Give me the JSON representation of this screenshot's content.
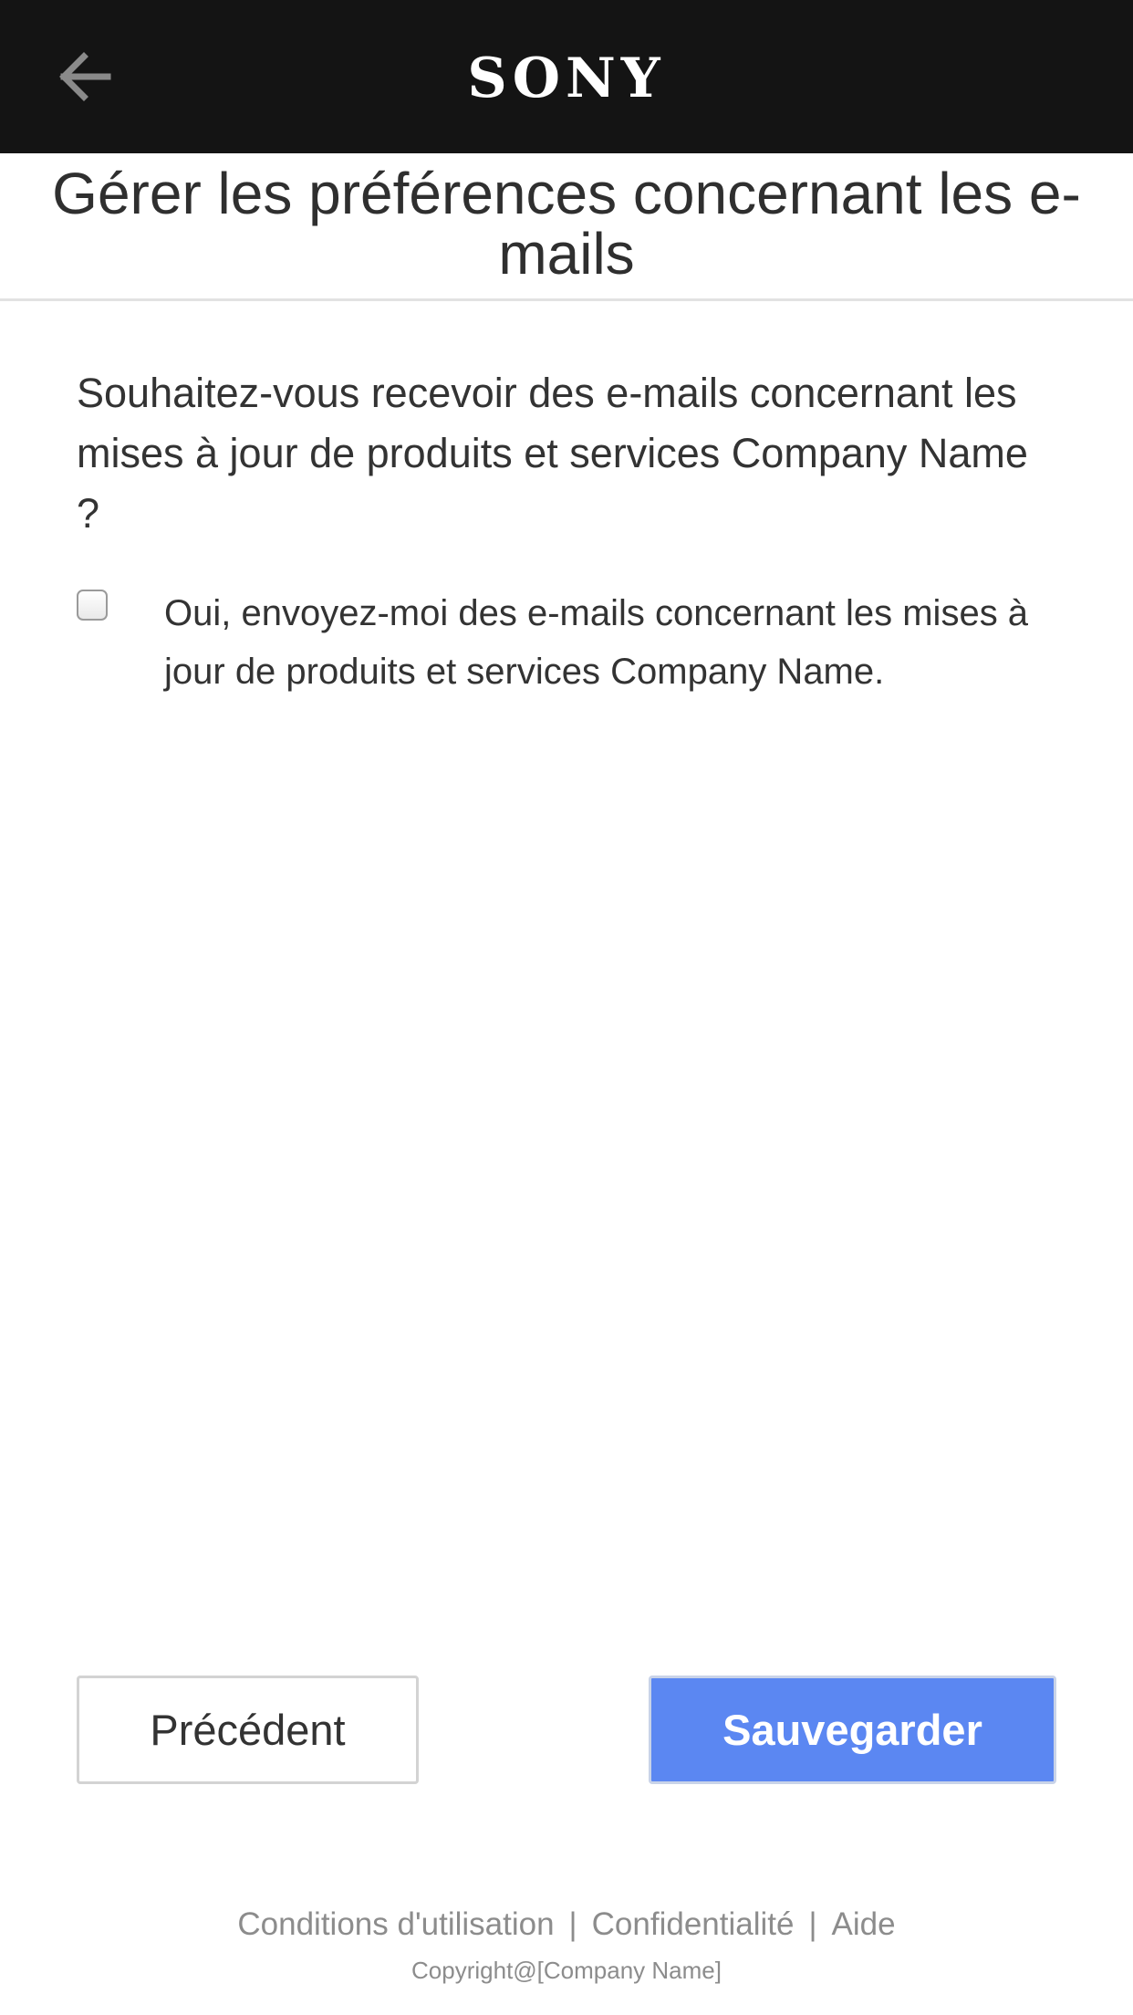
{
  "header": {
    "back_icon": "arrow-left-icon",
    "logo_text": "SONY"
  },
  "page": {
    "title": "Gérer les préférences concernant les e-mails"
  },
  "form": {
    "question": "Souhaitez-vous recevoir des e-mails concernant les mises à jour de produits et services Company Name ?",
    "checkbox_checked": false,
    "checkbox_label": "Oui, envoyez-moi des e-mails concernant les mises à jour de produits et services Company Name."
  },
  "buttons": {
    "previous_label": "Précédent",
    "save_label": "Sauvegarder"
  },
  "footer": {
    "links": [
      "Conditions d'utilisation",
      "Confidentialité",
      "Aide"
    ],
    "separator": "|",
    "copyright": "Copyright@[Company Name]"
  },
  "colors": {
    "header_bg": "#141414",
    "primary_button": "#5b87f2",
    "footer_text": "#8c8c8c"
  }
}
